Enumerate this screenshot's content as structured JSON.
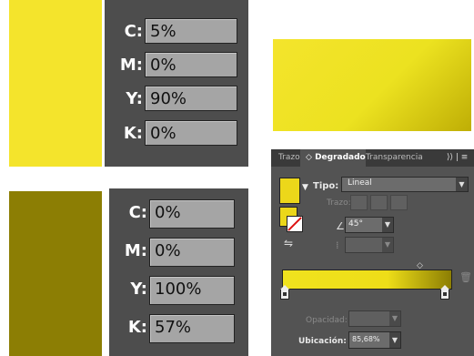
{
  "swatches": {
    "top": {
      "color": "#f4e42c"
    },
    "bottom": {
      "color": "#8c7e04"
    }
  },
  "cmyk_top": {
    "c": {
      "label": "C:",
      "value": "5%"
    },
    "m": {
      "label": "M:",
      "value": "0%"
    },
    "y": {
      "label": "Y:",
      "value": "90%"
    },
    "k": {
      "label": "K:",
      "value": "0%"
    }
  },
  "cmyk_bottom": {
    "c": {
      "label": "C:",
      "value": "0%"
    },
    "m": {
      "label": "M:",
      "value": "0%"
    },
    "y": {
      "label": "Y:",
      "value": "100%"
    },
    "k": {
      "label": "K:",
      "value": "57%"
    }
  },
  "gradient_panel": {
    "tabs": {
      "stroke": "Trazo",
      "gradient": "Degradado",
      "transparency": "Transparencia",
      "menu": "⟩⟩ | ≡"
    },
    "type_label": "Tipo:",
    "type_value": "Lineal",
    "stroke_label": "Trazo:",
    "angle_value": "45°",
    "opacity_label": "Opacidad:",
    "location_label": "Ubicación:",
    "location_value": "85,68%",
    "colors": {
      "start": "#f0e21e",
      "end": "#8c7e04"
    },
    "icons": {
      "angle": "angle-icon",
      "ratio": "aspect-ratio-icon",
      "reverse": "reverse-gradient-icon",
      "delete": "trash-icon",
      "dropdown": "chevron-down-icon"
    }
  }
}
